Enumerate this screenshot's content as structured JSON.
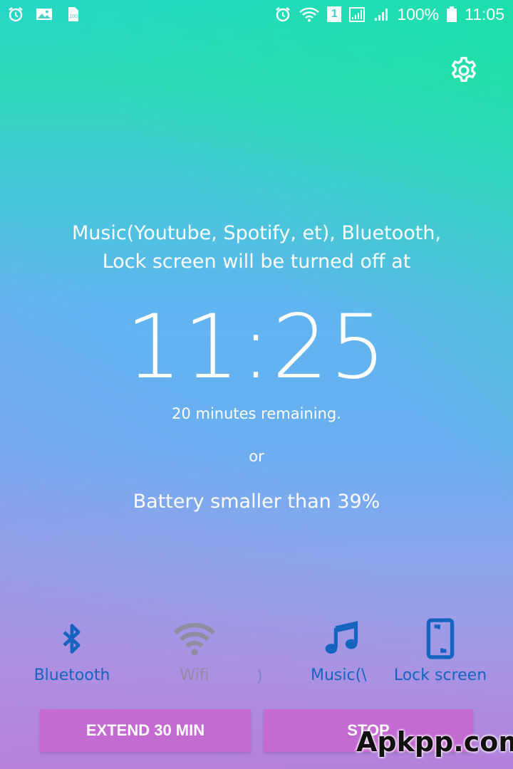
{
  "status_bar": {
    "left_icons": [
      "alarm-icon",
      "image-icon",
      "sd-card-icon"
    ],
    "right_icons": [
      "alarm-icon",
      "wifi-icon",
      "sim-icon",
      "signal-icon",
      "signal-icon",
      "battery-icon"
    ],
    "sim_number": "1",
    "battery_percent": "100%",
    "time": "11:05"
  },
  "header": {
    "settings_icon": "gear-icon"
  },
  "main": {
    "message_line1": "Music(Youtube, Spotify, et), Bluetooth,",
    "message_line2": "Lock screen will be turned off at",
    "time": "11:25",
    "remaining": "20 minutes remaining.",
    "or": "or",
    "battery_condition": "Battery smaller than 39%"
  },
  "toggles": [
    {
      "label": "Bluetooth",
      "icon": "bluetooth-icon",
      "state": "active"
    },
    {
      "label": "Wifi",
      "icon": "wifi-icon",
      "state": "inactive"
    },
    {
      "label": "Music(\\",
      "icon": "music-note-icon",
      "state": "active"
    },
    {
      "label": "Lock screen",
      "icon": "phone-icon",
      "state": "active"
    }
  ],
  "partial_label": ")",
  "buttons": {
    "extend_label": "EXTEND 30 MIN",
    "stop_label": "STOP"
  },
  "watermark": "Apkpp.com",
  "colors": {
    "button": "#c46ad3",
    "active_icon": "#1565c0",
    "inactive_icon": "#8a8a8a",
    "text": "#ffffff"
  }
}
